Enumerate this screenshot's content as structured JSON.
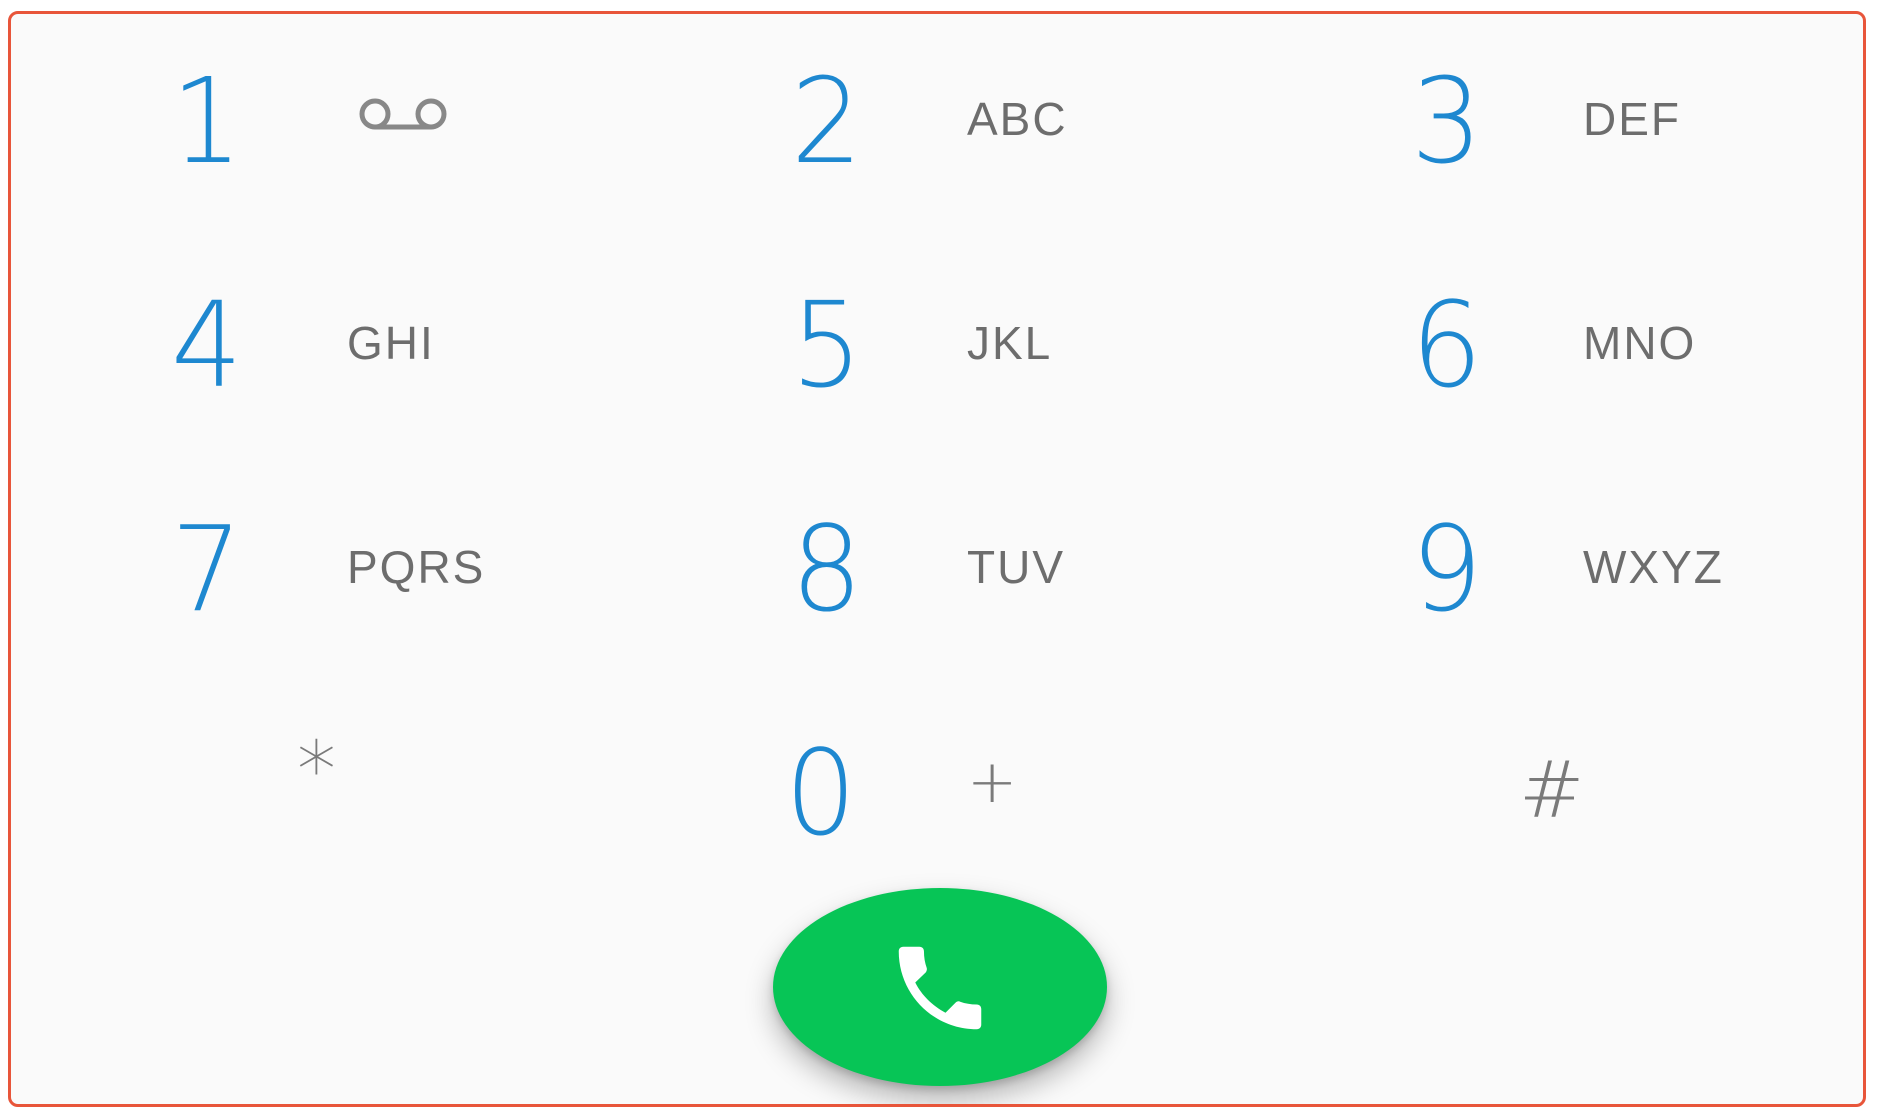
{
  "dialpad": {
    "keys": [
      {
        "digit": "1",
        "letters": "",
        "sub_icon": "voicemail-icon"
      },
      {
        "digit": "2",
        "letters": "ABC"
      },
      {
        "digit": "3",
        "letters": "DEF"
      },
      {
        "digit": "4",
        "letters": "GHI"
      },
      {
        "digit": "5",
        "letters": "JKL"
      },
      {
        "digit": "6",
        "letters": "MNO"
      },
      {
        "digit": "7",
        "letters": "PQRS"
      },
      {
        "digit": "8",
        "letters": "TUV"
      },
      {
        "digit": "9",
        "letters": "WXYZ"
      },
      {
        "digit": "*",
        "letters": ""
      },
      {
        "digit": "0",
        "letters": "+"
      },
      {
        "digit": "#",
        "letters": ""
      }
    ]
  },
  "call_button": {
    "icon": "phone-icon",
    "color": "#07c556"
  },
  "colors": {
    "digit": "#1e88d0",
    "letters": "#6d6d6d",
    "border": "#e8553a",
    "background": "#fafafa"
  }
}
